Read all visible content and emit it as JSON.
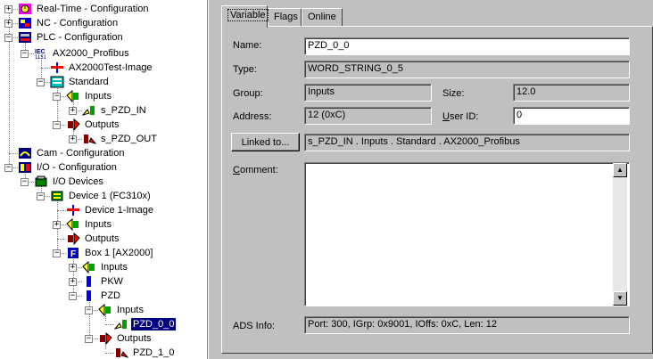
{
  "tree": {
    "nodes": [
      {
        "label": "Real-Time - Configuration",
        "icon": "realtime-icon"
      },
      {
        "label": "NC - Configuration",
        "icon": "nc-icon"
      },
      {
        "label": "PLC - Configuration",
        "icon": "plc-icon"
      },
      {
        "label": "AX2000_Profibus",
        "icon": "iec-icon",
        "icon_text": "IEC 1131"
      },
      {
        "label": "AX2000Test-Image",
        "icon": "image-icon"
      },
      {
        "label": "Standard",
        "icon": "task-icon"
      },
      {
        "label": "Inputs",
        "icon": "inputs-icon"
      },
      {
        "label": "s_PZD_IN",
        "icon": "input-var-icon"
      },
      {
        "label": "Outputs",
        "icon": "outputs-icon"
      },
      {
        "label": "s_PZD_OUT",
        "icon": "output-var-icon"
      },
      {
        "label": "Cam - Configuration",
        "icon": "cam-icon"
      },
      {
        "label": "I/O - Configuration",
        "icon": "io-icon"
      },
      {
        "label": "I/O Devices",
        "icon": "io-devices-icon"
      },
      {
        "label": "Device 1 (FC310x)",
        "icon": "device-icon"
      },
      {
        "label": "Device 1-Image",
        "icon": "image-icon"
      },
      {
        "label": "Inputs",
        "icon": "inputs-icon"
      },
      {
        "label": "Outputs",
        "icon": "outputs-icon"
      },
      {
        "label": "Box 1 [AX2000]",
        "icon": "box-icon",
        "icon_text": "F"
      },
      {
        "label": "Inputs",
        "icon": "inputs-icon"
      },
      {
        "label": "PKW",
        "icon": "pkw-icon"
      },
      {
        "label": "PZD",
        "icon": "pzd-icon"
      },
      {
        "label": "Inputs",
        "icon": "inputs-icon"
      },
      {
        "label": "PZD_0_0",
        "icon": "input-var-icon"
      },
      {
        "label": "Outputs",
        "icon": "outputs-icon"
      },
      {
        "label": "PZD_1_0",
        "icon": "output-var-icon"
      }
    ]
  },
  "tabs": [
    "Variable",
    "Flags",
    "Online"
  ],
  "form": {
    "name_label": "Name:",
    "name_value": "PZD_0_0",
    "type_label": "Type:",
    "type_value": "WORD_STRING_0_5",
    "group_label": "Group:",
    "group_value": "Inputs",
    "size_label": "Size:",
    "size_value": "12.0",
    "address_label": "Address:",
    "address_value": "12 (0xC)",
    "userid_label_u": "U",
    "userid_label_rest": "ser ID:",
    "userid_value": "0",
    "linked_button": "Linked to...",
    "linked_value": "s_PZD_IN . Inputs . Standard . AX2000_Profibus",
    "comment_label_u": "C",
    "comment_label_rest": "omment:",
    "comment_value": "",
    "ads_label": "ADS Info:",
    "ads_value": "Port: 300, IGrp: 0x9001, IOffs: 0xC, Len: 12"
  },
  "colors": {
    "selection": "#000080",
    "window_bg": "#c0c0c0"
  }
}
